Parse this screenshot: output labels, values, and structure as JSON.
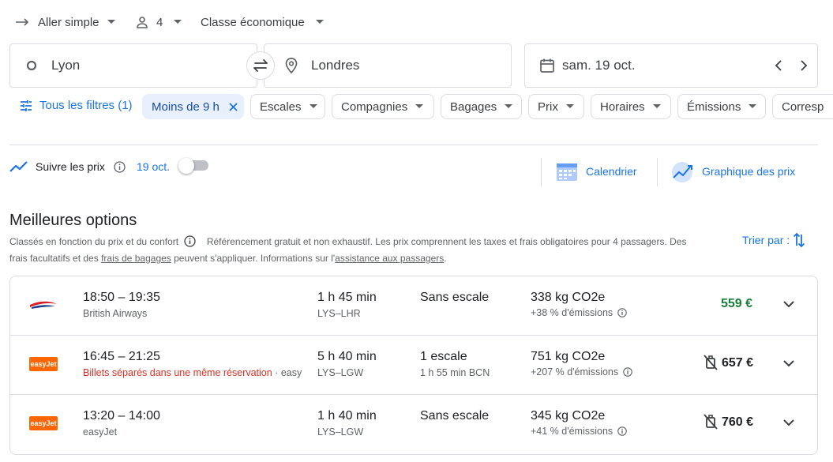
{
  "top": {
    "trip_type": "Aller simple",
    "passengers": "4",
    "cabin": "Classe économique"
  },
  "search": {
    "origin": "Lyon",
    "destination": "Londres",
    "date": "sam. 19 oct."
  },
  "filters": {
    "all": "Tous les filtres (1)",
    "active": "Moins de 9 h",
    "chips": [
      "Escales",
      "Compagnies",
      "Bagages",
      "Prix",
      "Horaires",
      "Émissions",
      "Corresp"
    ]
  },
  "track": {
    "label": "Suivre les prix",
    "date": "19 oct.",
    "calendar": "Calendrier",
    "graph": "Graphique des prix"
  },
  "best": {
    "title": "Meilleures options",
    "desc_part1": "Classés en fonction du prix et du confort",
    "desc_part2": "Référencement gratuit et non exhaustif. Les prix comprennent les taxes et frais obligatoires pour 4 passagers. Des",
    "desc_line2_a": "frais facultatifs et des ",
    "desc_link1": "frais de bagages",
    "desc_line2_b": " peuvent s'appliquer. Informations sur l'",
    "desc_link2": "assistance aux passagers",
    "desc_line2_c": ".",
    "sort": "Trier par :"
  },
  "flights": [
    {
      "times": "18:50 – 19:35",
      "airline": "British Airways",
      "duration": "1 h 45 min",
      "route": "LYS–LHR",
      "stops": "Sans escale",
      "stop_detail": "",
      "co2": "338 kg CO2e",
      "emissions": "+38 % d'émissions",
      "price": "559 €",
      "logo": "ba"
    },
    {
      "times": "16:45 – 21:25",
      "airline": "Billets séparés dans une même réservation",
      "airline_extra": " · easy",
      "duration": "5 h 40 min",
      "route": "LYS–LGW",
      "stops": "1 escale",
      "stop_detail": "1 h 55 min BCN",
      "co2": "751 kg CO2e",
      "emissions": "+207 % d'émissions",
      "price": "657 €",
      "logo": "easyJet"
    },
    {
      "times": "13:20 – 14:00",
      "airline": "easyJet",
      "duration": "1 h 40 min",
      "route": "LYS–LGW",
      "stops": "Sans escale",
      "stop_detail": "",
      "co2": "345 kg CO2e",
      "emissions": "+41 % d'émissions",
      "price": "760 €",
      "logo": "easyJet"
    }
  ],
  "colors": {
    "accent": "#1a73e8",
    "chip_active_bg": "#e8f0fe",
    "price_green": "#188038",
    "warning_red": "#d93025",
    "easyjet_orange": "#ff6600"
  }
}
